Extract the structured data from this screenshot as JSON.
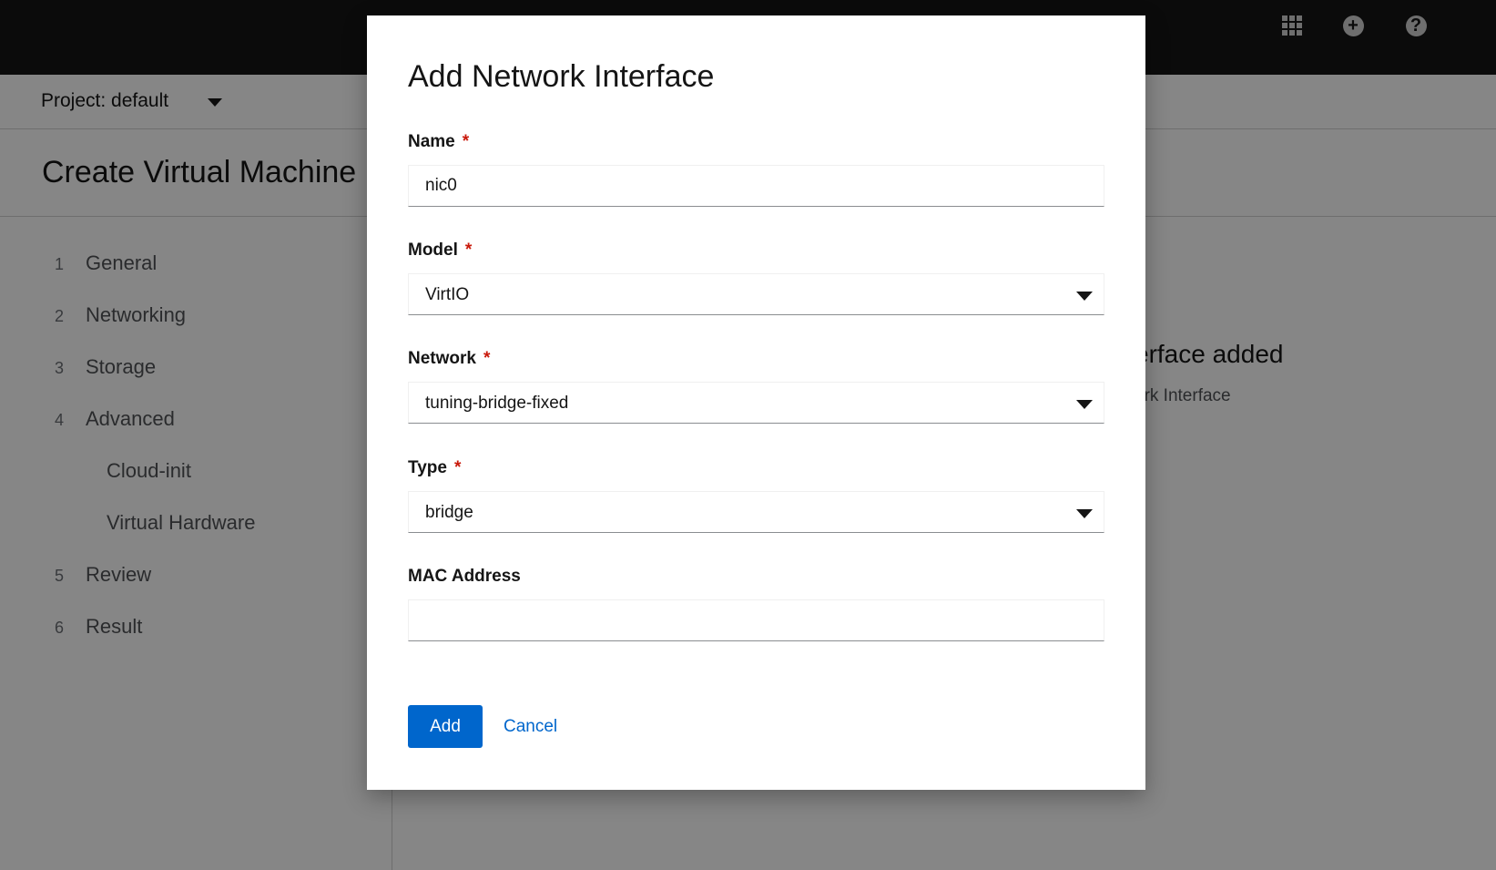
{
  "masthead": {
    "icons": [
      "app-launcher-icon",
      "plus-circle-icon",
      "help-icon"
    ],
    "plus_glyph": "+",
    "help_glyph": "?"
  },
  "project": {
    "label": "Project: default"
  },
  "page": {
    "title": "Create Virtual Machine"
  },
  "wizard": {
    "steps": [
      {
        "num": "1",
        "label": "General"
      },
      {
        "num": "2",
        "label": "Networking"
      },
      {
        "num": "3",
        "label": "Storage"
      },
      {
        "num": "4",
        "label": "Advanced"
      },
      {
        "num": "5",
        "label": "Review"
      },
      {
        "num": "6",
        "label": "Result"
      }
    ],
    "substeps": [
      "Cloud-init",
      "Virtual Hardware"
    ]
  },
  "background": {
    "empty_title_partial": "erface added",
    "empty_sub_partial": "ork Interface"
  },
  "modal": {
    "title": "Add Network Interface",
    "required_mark": "*",
    "name": {
      "label": "Name",
      "value": "nic0"
    },
    "model": {
      "label": "Model",
      "value": "VirtIO"
    },
    "network": {
      "label": "Network",
      "value": "tuning-bridge-fixed"
    },
    "type": {
      "label": "Type",
      "value": "bridge"
    },
    "mac": {
      "label": "MAC Address",
      "value": ""
    },
    "add_label": "Add",
    "cancel_label": "Cancel"
  },
  "colors": {
    "primary": "#0066cc",
    "required": "#c9190b",
    "masthead": "#151515"
  }
}
